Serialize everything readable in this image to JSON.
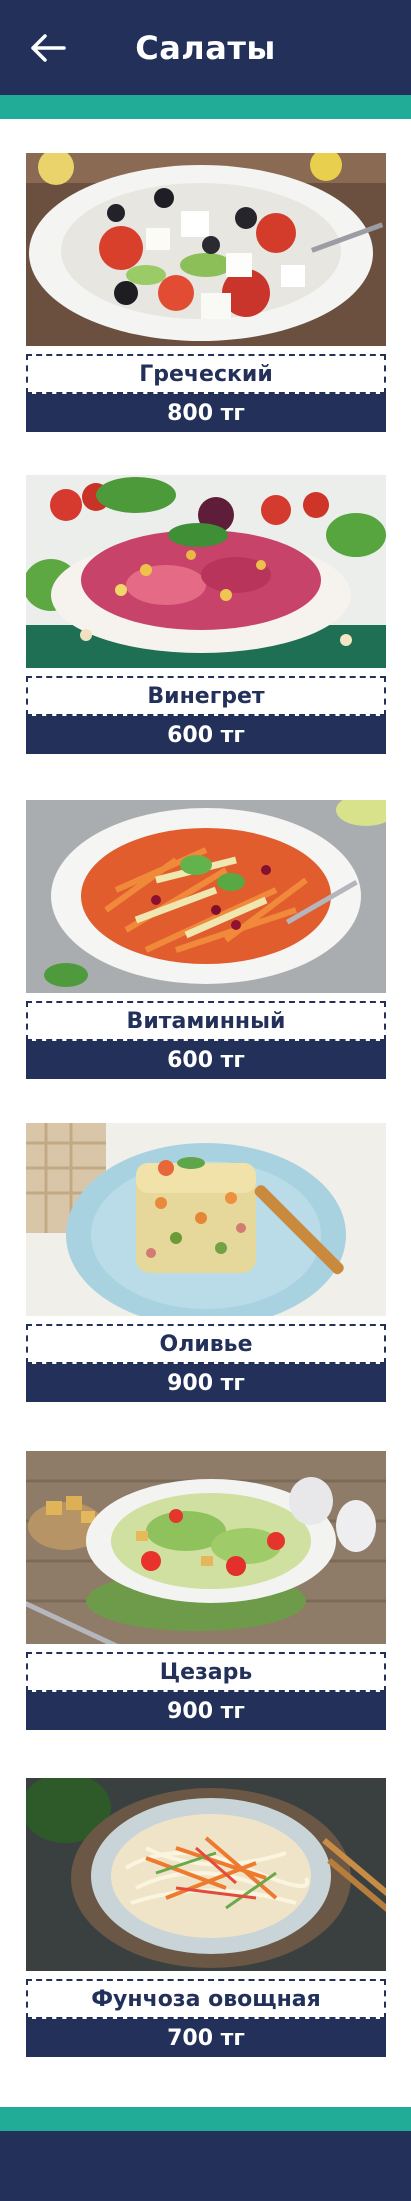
{
  "header": {
    "title": "Салаты",
    "back_icon": "arrow-left-icon",
    "bg_color": "#22305a",
    "accent_color": "#21ac98"
  },
  "items": [
    {
      "name": "Греческий",
      "price": "800 тг"
    },
    {
      "name": "Винегрет",
      "price": "600 тг"
    },
    {
      "name": "Витаминный",
      "price": "600 тг"
    },
    {
      "name": "Оливье",
      "price": "900 тг"
    },
    {
      "name": "Цезарь",
      "price": "900 тг"
    },
    {
      "name": "Фунчоза овощная",
      "price": "700 тг"
    }
  ]
}
